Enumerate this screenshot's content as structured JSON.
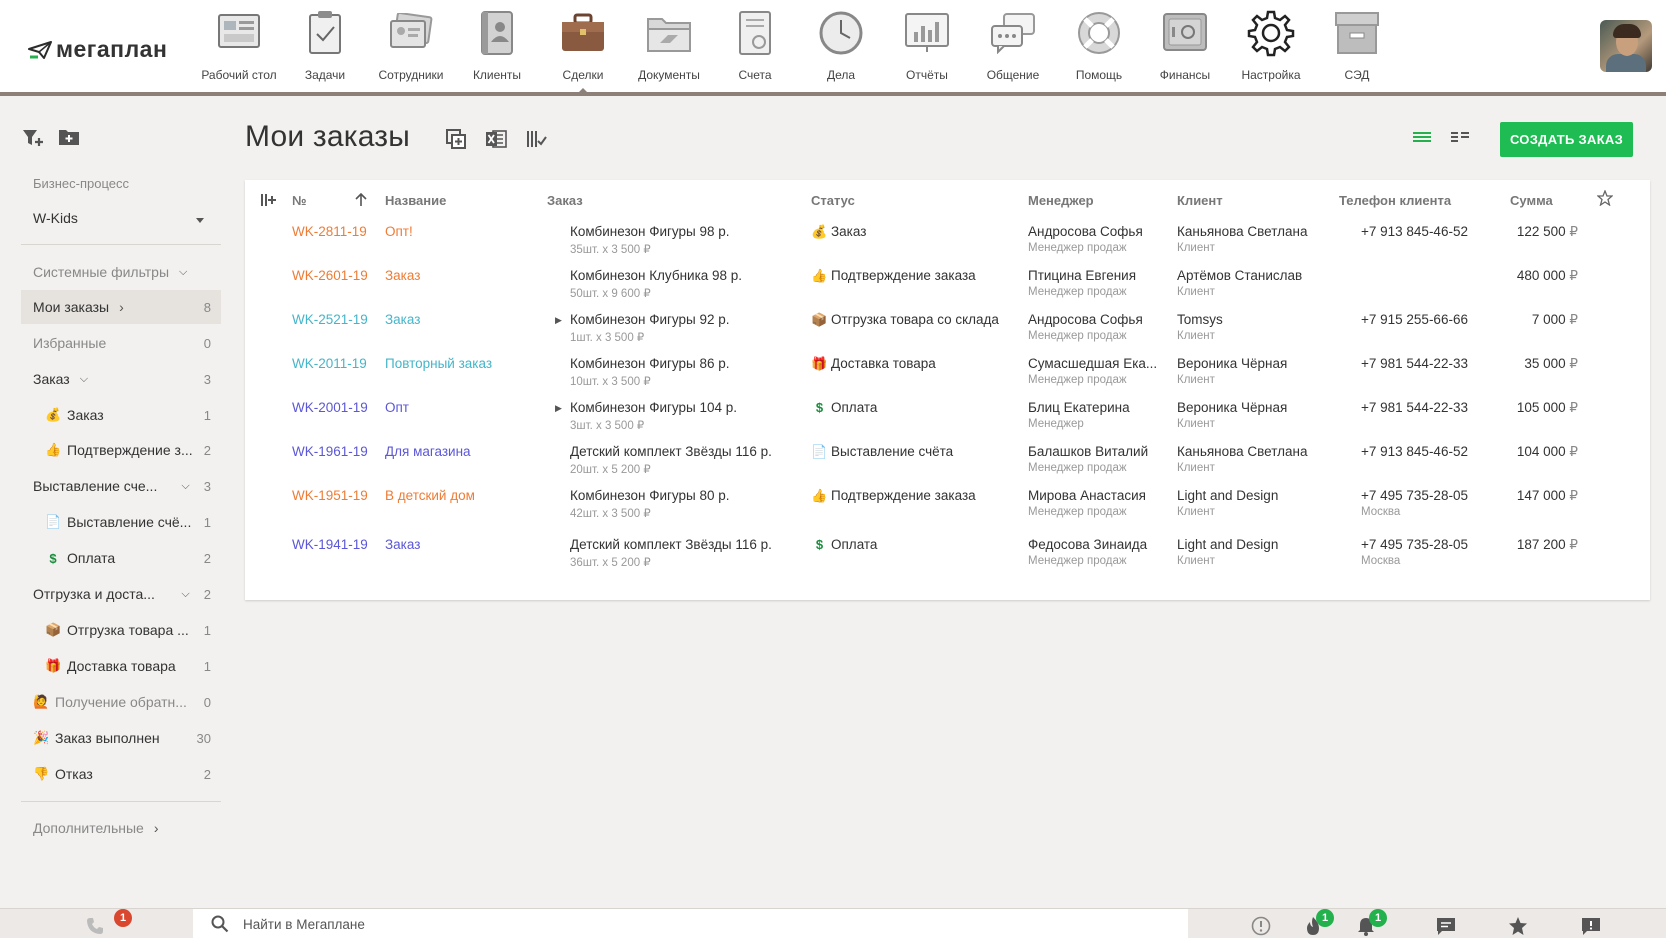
{
  "app": {
    "logo_text": "мегаплан"
  },
  "nav": [
    {
      "label": "Рабочий стол",
      "icon": "desktop-icon"
    },
    {
      "label": "Задачи",
      "icon": "tasks-icon"
    },
    {
      "label": "Сотрудники",
      "icon": "employees-icon"
    },
    {
      "label": "Клиенты",
      "icon": "clients-icon"
    },
    {
      "label": "Сделки",
      "icon": "deals-icon",
      "active": true
    },
    {
      "label": "Документы",
      "icon": "documents-icon"
    },
    {
      "label": "Счета",
      "icon": "invoices-icon"
    },
    {
      "label": "Дела",
      "icon": "clock-icon"
    },
    {
      "label": "Отчёты",
      "icon": "reports-icon"
    },
    {
      "label": "Общение",
      "icon": "chat-icon"
    },
    {
      "label": "Помощь",
      "icon": "lifebuoy-icon"
    },
    {
      "label": "Финансы",
      "icon": "safe-icon"
    },
    {
      "label": "Настройка",
      "icon": "gear-icon"
    },
    {
      "label": "СЭД",
      "icon": "archive-icon"
    }
  ],
  "sidebar": {
    "bp_label": "Бизнес-процесс",
    "bp_value": "W-Kids",
    "system_filters": "Системные фильтры",
    "items": [
      {
        "label": "Мои заказы",
        "count": "8"
      },
      {
        "label": "Избранные",
        "count": "0"
      },
      {
        "label": "Заказ",
        "count": "3"
      },
      {
        "label": "Заказ",
        "count": "1"
      },
      {
        "label": "Подтверждение з...",
        "count": "2"
      },
      {
        "label": "Выставление сче...",
        "count": "3"
      },
      {
        "label": "Выставление счё...",
        "count": "1"
      },
      {
        "label": "Оплата",
        "count": "2"
      },
      {
        "label": "Отгрузка и доста...",
        "count": "2"
      },
      {
        "label": "Отгрузка товара ...",
        "count": "1"
      },
      {
        "label": "Доставка товара",
        "count": "1"
      },
      {
        "label": "Получение обратн...",
        "count": "0"
      },
      {
        "label": "Заказ выполнен",
        "count": "30"
      },
      {
        "label": "Отказ",
        "count": "2"
      }
    ],
    "additional": "Дополнительные"
  },
  "main": {
    "title": "Мои заказы",
    "create_label": "СОЗДАТЬ ЗАКАЗ",
    "columns": {
      "num": "№",
      "name": "Название",
      "order": "Заказ",
      "status": "Статус",
      "manager": "Менеджер",
      "client": "Клиент",
      "phone": "Телефон клиента",
      "sum": "Сумма"
    },
    "rows": [
      {
        "num": "WK-2811-19",
        "name": "Опт!",
        "order": "Комбинезон Фигуры 98 р.",
        "qty": "35шт. x 3 500 ₽",
        "status": "Заказ",
        "status_icon": "money-bag-icon",
        "manager": "Андросова Софья",
        "manager_role": "Менеджер продаж",
        "client": "Каньянова Светлана",
        "client_role": "Клиент",
        "phone": "+7 913 845-46-52",
        "phone_sub": "",
        "sum": "122 500",
        "cur": "₽"
      },
      {
        "num": "WK-2601-19",
        "name": "Заказ",
        "order": "Комбинезон Клубника 98 р.",
        "qty": "50шт. x 9 600 ₽",
        "status": "Подтверждение заказа",
        "status_icon": "thumbs-up-icon",
        "manager": "Птицина Евгения",
        "manager_role": "Менеджер продаж",
        "client": "Артёмов Станислав",
        "client_role": "Клиент",
        "phone": "",
        "phone_sub": "",
        "sum": "480 000",
        "cur": "₽"
      },
      {
        "num": "WK-2521-19",
        "name": "Заказ",
        "order": "Комбинезон Фигуры 92 р.",
        "qty": "1шт. x 3 500 ₽",
        "status": "Отгрузка товара со склада",
        "status_icon": "box-icon",
        "manager": "Андросова Софья",
        "manager_role": "Менеджер продаж",
        "client": "Tomsys",
        "client_role": "Клиент",
        "phone": "+7 915 255-66-66",
        "phone_sub": "",
        "sum": "7 000",
        "cur": "₽"
      },
      {
        "num": "WK-2011-19",
        "name": "Повторный заказ",
        "order": "Комбинезон Фигуры 86 р.",
        "qty": "10шт. x 3 500 ₽",
        "status": "Доставка товара",
        "status_icon": "gift-icon",
        "manager": "Сумасшедшая Ека...",
        "manager_role": "Менеджер продаж",
        "client": "Вероника Чёрная",
        "client_role": "Клиент",
        "phone": "+7 981 544-22-33",
        "phone_sub": "",
        "sum": "35 000",
        "cur": "₽"
      },
      {
        "num": "WK-2001-19",
        "name": "Опт",
        "order": "Комбинезон Фигуры 104 р.",
        "qty": "3шт. x 3 500 ₽",
        "status": "Оплата",
        "status_icon": "dollar-icon",
        "manager": "Блиц Екатерина",
        "manager_role": "Менеджер",
        "client": "Вероника Чёрная",
        "client_role": "Клиент",
        "phone": "+7 981 544-22-33",
        "phone_sub": "",
        "sum": "105 000",
        "cur": "₽"
      },
      {
        "num": "WK-1961-19",
        "name": "Для магазина",
        "order": "Детский комплект Звёзды 116 р.",
        "qty": "20шт. x 5 200 ₽",
        "status": "Выставление счёта",
        "status_icon": "invoice-icon",
        "manager": "Балашков Виталий",
        "manager_role": "Менеджер продаж",
        "client": "Каньянова Светлана",
        "client_role": "Клиент",
        "phone": "+7 913 845-46-52",
        "phone_sub": "",
        "sum": "104 000",
        "cur": "₽"
      },
      {
        "num": "WK-1951-19",
        "name": "В детский дом",
        "order": "Комбинезон Фигуры 80 р.",
        "qty": "42шт. x 3 500 ₽",
        "status": "Подтверждение заказа",
        "status_icon": "thumbs-up-icon",
        "manager": "Мирова Анастасия",
        "manager_role": "Менеджер продаж",
        "client": "Light and Design",
        "client_role": "Клиент",
        "phone": "+7 495 735-28-05",
        "phone_sub": "Москва",
        "sum": "147 000",
        "cur": "₽"
      },
      {
        "num": "WK-1941-19",
        "name": "Заказ",
        "order": "Детский комплект Звёзды 116 р.",
        "qty": "36шт. x 5 200 ₽",
        "status": "Оплата",
        "status_icon": "dollar-icon",
        "manager": "Федосова Зинаида",
        "manager_role": "Менеджер продаж",
        "client": "Light and Design",
        "client_role": "Клиент",
        "phone": "+7 495 735-28-05",
        "phone_sub": "Москва",
        "sum": "187 200",
        "cur": "₽"
      }
    ]
  },
  "bottombar": {
    "search_placeholder": "Найти в Мегаплане",
    "phone_badge": "1",
    "fire_badge": "1",
    "bell_badge": "1"
  }
}
